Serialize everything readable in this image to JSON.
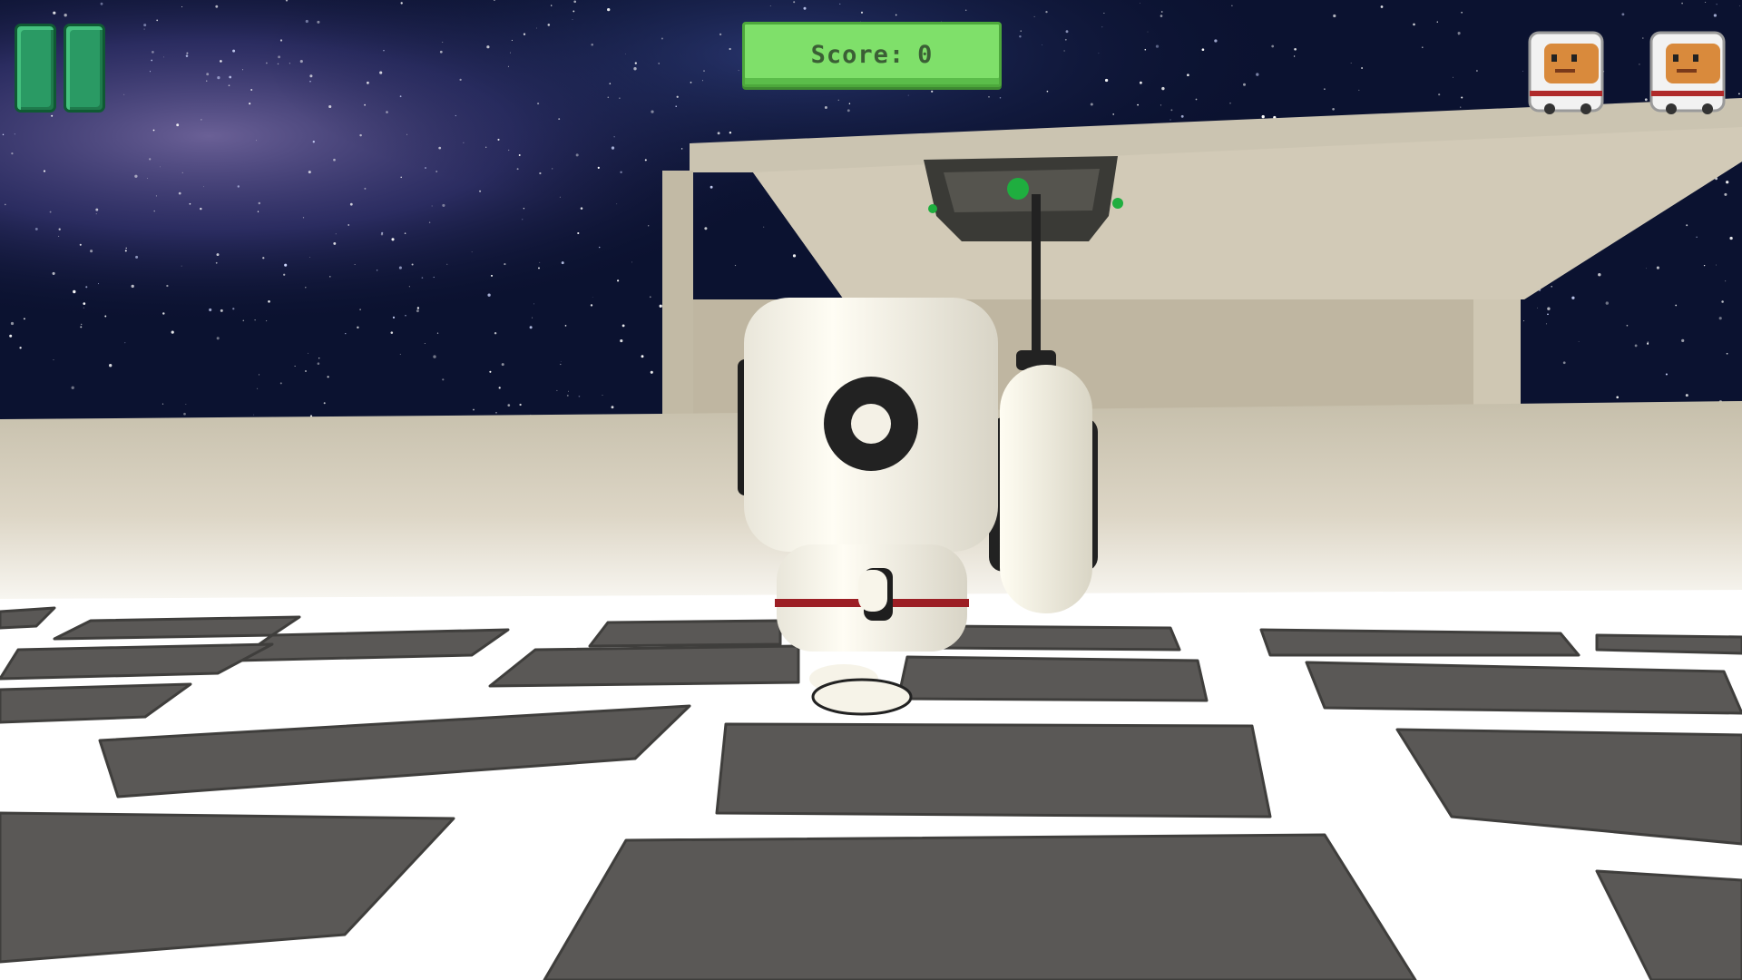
{
  "hud": {
    "score_label": "Score:",
    "score_value": "0",
    "lives": [
      {
        "icon": "astronaut-life-icon"
      },
      {
        "icon": "astronaut-life-icon"
      }
    ],
    "pause_icon": "pause-icon"
  },
  "colors": {
    "score_panel": "#7fe06a",
    "score_text": "#3b5f35",
    "pause_button": "#2a9a64",
    "floor": "#ffffff",
    "floor_tiles": "#5a5856",
    "station_walls": "#c8c0ad",
    "sky": "#0b1230"
  }
}
